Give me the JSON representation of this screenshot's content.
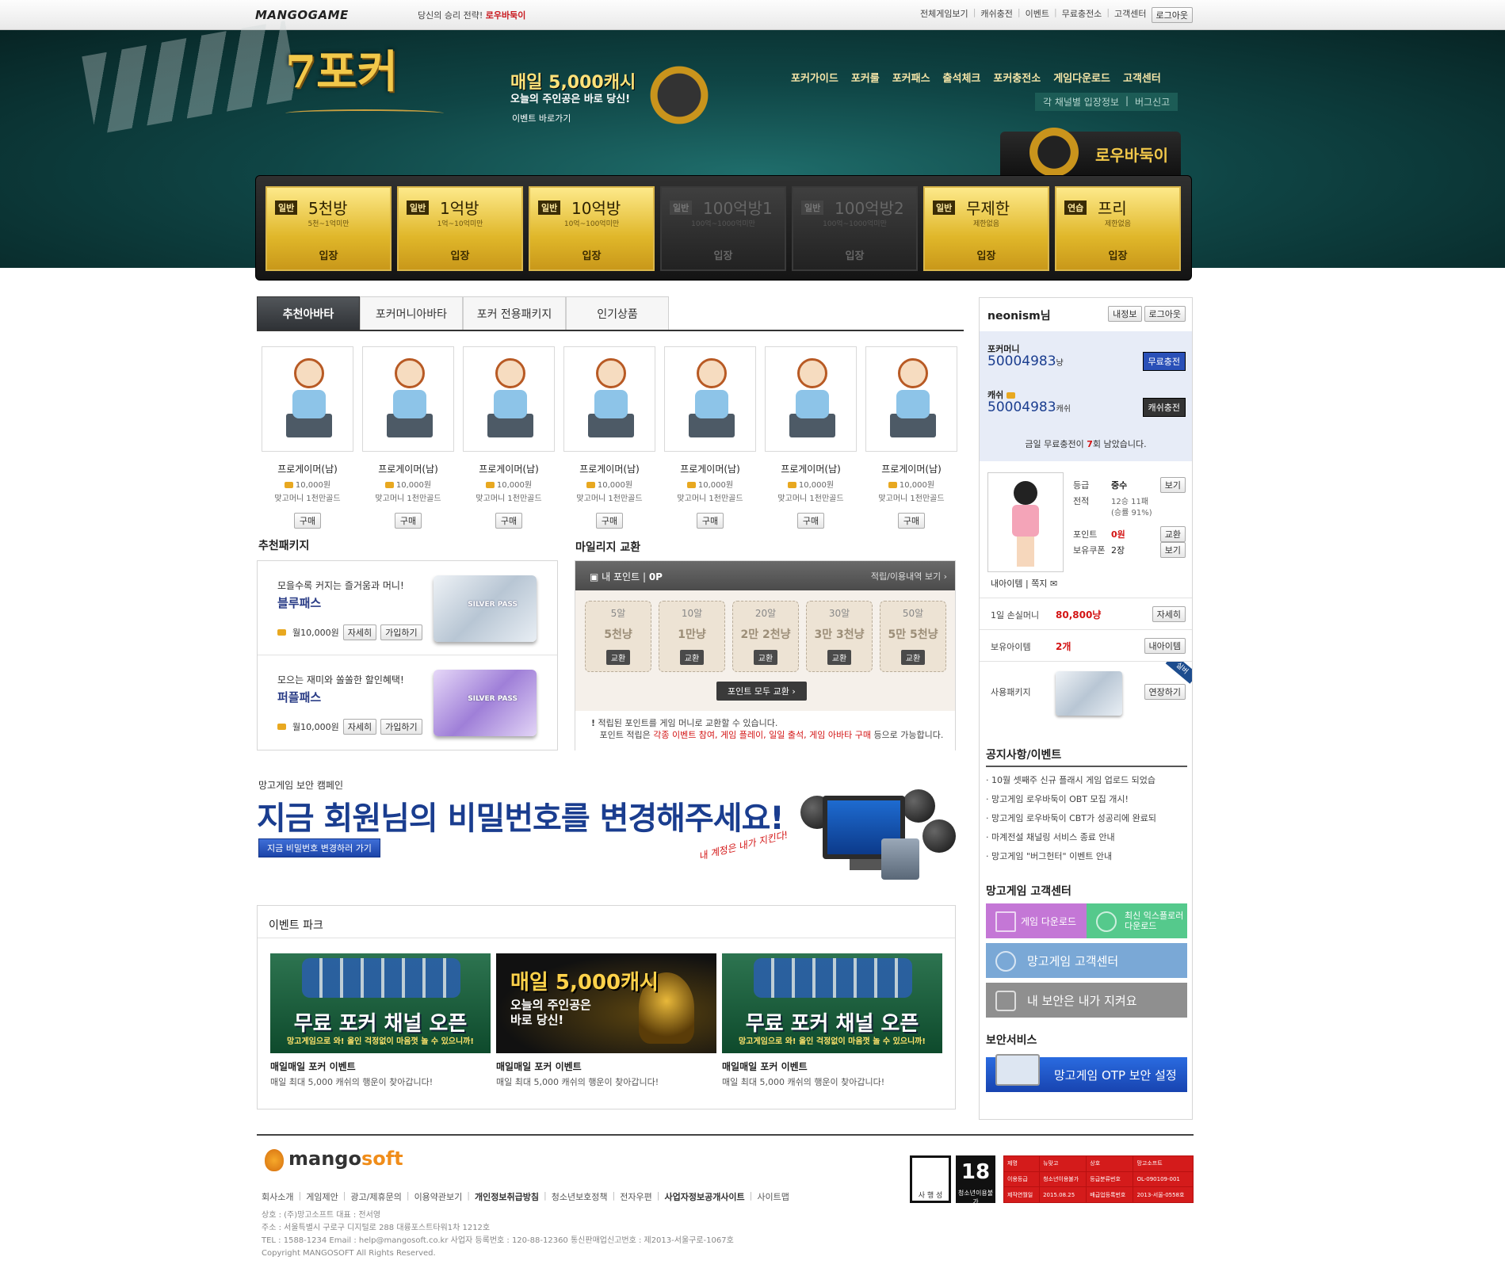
{
  "topbar": {
    "logo": "MANGOGAME",
    "slogan_prefix": "당신의 승리 전략!",
    "slogan_brand": "로우바둑이",
    "nav": [
      "전체게임보기",
      "캐쉬충전",
      "이벤트",
      "무료충전소",
      "고객센터"
    ],
    "logout": "로그아웃"
  },
  "header": {
    "game_title": "7포커",
    "event_headline": "매일 5,000캐시",
    "event_sub": "오늘의 주인공은 바로 당신!",
    "event_link": "이벤트 바로가기",
    "main_nav": [
      "포커가이드",
      "포커룰",
      "포커패스",
      "출석체크",
      "포커충전소",
      "게임다운로드",
      "고객센터"
    ],
    "sub_nav": [
      "각 채널별 입장정보",
      "버그신고"
    ],
    "lowu_label": "로우바둑이"
  },
  "rooms": [
    {
      "tag": "일반",
      "name": "5천방",
      "range": "5천~1억미만",
      "enter": "입장",
      "active": true
    },
    {
      "tag": "일반",
      "name": "1억방",
      "range": "1억~10억미만",
      "enter": "입장",
      "active": true
    },
    {
      "tag": "일반",
      "name": "10억방",
      "range": "10억~100억미만",
      "enter": "입장",
      "active": true
    },
    {
      "tag": "일반",
      "name": "100억방1",
      "range": "100억~1000억미만",
      "enter": "입장",
      "active": false
    },
    {
      "tag": "일반",
      "name": "100억방2",
      "range": "100억~1000억미만",
      "enter": "입장",
      "active": false
    },
    {
      "tag": "일반",
      "name": "무제한",
      "range": "제한없음",
      "enter": "입장",
      "active": true
    },
    {
      "tag": "연습",
      "name": "프리",
      "range": "제한없음",
      "enter": "입장",
      "active": true
    }
  ],
  "tabs": [
    "추천아바타",
    "포커머니아바타",
    "포커 전용패키지",
    "인기상품"
  ],
  "avatars": [
    {
      "name": "프로게이머(남)",
      "price": "10,000원",
      "desc": "맞고머니 1천만골드",
      "buy": "구매"
    },
    {
      "name": "프로게이머(남)",
      "price": "10,000원",
      "desc": "맞고머니 1천만골드",
      "buy": "구매"
    },
    {
      "name": "프로게이머(남)",
      "price": "10,000원",
      "desc": "맞고머니 1천만골드",
      "buy": "구매"
    },
    {
      "name": "프로게이머(남)",
      "price": "10,000원",
      "desc": "맞고머니 1천만골드",
      "buy": "구매"
    },
    {
      "name": "프로게이머(남)",
      "price": "10,000원",
      "desc": "맞고머니 1천만골드",
      "buy": "구매"
    },
    {
      "name": "프로게이머(남)",
      "price": "10,000원",
      "desc": "맞고머니 1천만골드",
      "buy": "구매"
    },
    {
      "name": "프로게이머(남)",
      "price": "10,000원",
      "desc": "맞고머니 1천만골드",
      "buy": "구매"
    }
  ],
  "packages": {
    "heading": "추천패키지",
    "items": [
      {
        "desc": "모을수록 커지는 즐거움과 머니!",
        "title": "블루패스",
        "price": "월10,000원",
        "detail": "자세히",
        "join": "가입하기",
        "card_label": "SILVER PASS"
      },
      {
        "desc": "모으는 재미와 쏠쏠한 할인혜택!",
        "title": "퍼플패스",
        "price": "월10,000원",
        "detail": "자세히",
        "join": "가입하기",
        "card_label": "SILVER PASS"
      }
    ]
  },
  "mileage": {
    "heading": "마일리지 교환",
    "my_point_label": "내 포인트",
    "my_point": "0P",
    "history_link": "적립/이용내역 보기",
    "items": [
      {
        "amount": "5알",
        "value": "5천냥",
        "btn": "교환"
      },
      {
        "amount": "10알",
        "value": "1만냥",
        "btn": "교환"
      },
      {
        "amount": "20알",
        "value": "2만 2천냥",
        "btn": "교환"
      },
      {
        "amount": "30알",
        "value": "3만 3천냥",
        "btn": "교환"
      },
      {
        "amount": "50알",
        "value": "5만 5천냥",
        "btn": "교환"
      }
    ],
    "exchange_all": "포인트 모두 교환",
    "note1": "적립된 포인트를 게임 머니로 교환할 수 있습니다.",
    "note2_prefix": "포인트 적립은",
    "note2_highlight": "각종 이벤트 참여, 게임 플레이, 일일 출석, 게임 아바타 구매",
    "note2_suffix": "등으로 가능합니다."
  },
  "campaign": {
    "pre": "망고게임 보안 캠페인",
    "headline": "지금 회원님의 비밀번호를 변경해주세요!",
    "button": "지금 비밀번호 변경하러 가기",
    "scribble": "내 계정은 내가 지킨다!"
  },
  "event_park": {
    "heading": "이벤트 파크",
    "items": [
      {
        "banner_big": "무료 포커 채널 오픈",
        "banner_small": "망고게임으로 와! 올인 걱정없이 마음껏 놀 수 있으니까!",
        "title": "매일매일 포커 이벤트",
        "sub": "매일 최대 5,000 캐쉬의 행운이 찾아갑니다!"
      },
      {
        "banner_big": "매일 5,000캐시",
        "banner_small": "오늘의 주인공은 바로 당신!",
        "title": "매일매일 포커 이벤트",
        "sub": "매일 최대 5,000 캐쉬의 행운이 찾아갑니다!"
      },
      {
        "banner_big": "무료 포커 채널 오픈",
        "banner_small": "망고게임으로 와! 올인 걱정없이 마음껏 놀 수 있으니까!",
        "title": "매일매일 포커 이벤트",
        "sub": "매일 최대 5,000 캐쉬의 행운이 찾아갑니다!"
      }
    ]
  },
  "user": {
    "name": "neonism님",
    "info_btn": "내정보",
    "logout_btn": "로그아웃",
    "poker_money_label": "포커머니",
    "poker_money": "50004983",
    "poker_money_unit": "냥",
    "free_charge_btn": "무료충전",
    "cash_label": "캐쉬",
    "cash": "50004983",
    "cash_unit": "캐쉬",
    "cash_charge_btn": "캐쉬충전",
    "free_note_prefix": "금일 무료충전이",
    "free_note_count": "7",
    "free_note_suffix": "회 남았습니다.",
    "grade_label": "등급",
    "grade": "중수",
    "record_label": "전적",
    "record": "12승 11패",
    "win_rate": "(승률 91%)",
    "point_label": "포인트",
    "point": "0원",
    "coupon_label": "보유쿠폰",
    "coupon": "2장",
    "view": "보기",
    "exchange": "교환",
    "my_items_link": "내아이템",
    "note_link": "쪽지",
    "loss_label": "1일 손실머니",
    "loss": "80,800냥",
    "loss_btn": "자세히",
    "items_label": "보유아이템",
    "items": "2개",
    "items_btn": "내아이템",
    "pkg_label": "사용패키지",
    "pkg_btn": "연장하기",
    "pkg_ribbon": "실버"
  },
  "notices": {
    "heading": "공지사항/이벤트",
    "items": [
      "10월 셋째주 신규 플래시 게임 업로드 되었습",
      "망고게임 로우바둑이 OBT 모집 개시!",
      "망고게임 로우바둑이 CBT가 성공리에 완료되",
      "마계전설 채널링 서비스 종료 안내",
      "망고게임 \"버그헌터\" 이벤트 안내"
    ]
  },
  "support": {
    "heading": "망고게임 고객센터",
    "download": "게임 다운로드",
    "ie": "최신 익스플로러 다운로드",
    "center": "망고게임 고객센터",
    "security": "내 보안은 내가 지켜요"
  },
  "security_service": {
    "heading": "보안서비스",
    "otp": "망고게임 OTP 보안 설정"
  },
  "footer": {
    "brand_a": "mango",
    "brand_b": "soft",
    "links": [
      "회사소개",
      "게임제안",
      "광고/제휴문의",
      "이용약관보기",
      "개인정보취급방침",
      "청소년보호정책",
      "전자우편",
      "사업자정보공개사이트",
      "사이트맵"
    ],
    "info": [
      "상호 : (주)망고소프트 대표 : 전서영",
      "주소 : 서울특별시 구로구 디지털로 288 대륭포스트타워1차 1212호",
      "TEL : 1588-1234 Email : help@mangosoft.co.kr 사업자 등록번호 : 120-88-12360 통신판매업신고번호 : 제2013-서울구로-1067호",
      "Copyright MANGOSOFT All Rights Reserved."
    ],
    "rating_label1": "사 행 성",
    "rating_age": "18",
    "rating_label2": "청소년이용불가",
    "rating_table": [
      [
        "제명",
        "뉴맞고",
        "상호",
        "망고소프트"
      ],
      [
        "이용등급",
        "청소년이용불가",
        "등급분류번호",
        "OL-090109-001"
      ],
      [
        "제작연월일",
        "2015.08.25",
        "배급업등록번호",
        "2013-서울-0558호"
      ]
    ]
  },
  "colors": {
    "header_bg": "#0f4545",
    "gold": "#e0b72a",
    "accent_blue": "#1a3d8f",
    "red": "#d31414"
  }
}
